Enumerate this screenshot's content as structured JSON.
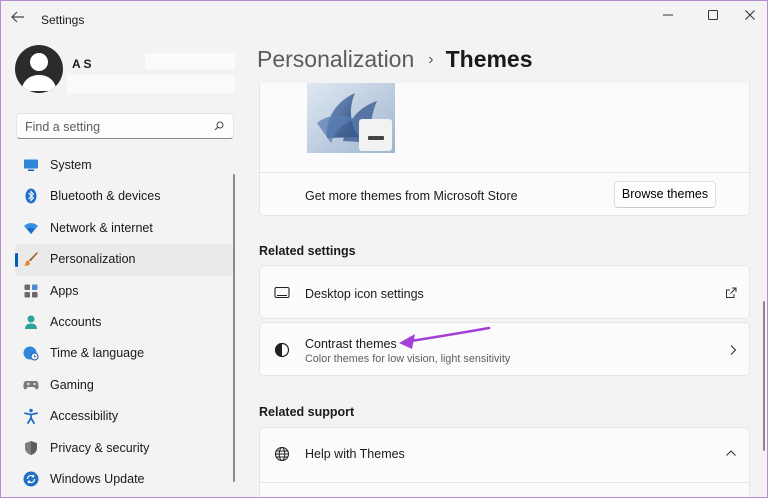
{
  "window": {
    "title": "Settings"
  },
  "profile": {
    "name": "A      S"
  },
  "search": {
    "placeholder": "Find a setting"
  },
  "nav": {
    "items": [
      {
        "label": "System",
        "icon": "monitor-icon"
      },
      {
        "label": "Bluetooth & devices",
        "icon": "bluetooth-icon"
      },
      {
        "label": "Network & internet",
        "icon": "wifi-icon"
      },
      {
        "label": "Personalization",
        "icon": "brush-icon",
        "active": true
      },
      {
        "label": "Apps",
        "icon": "apps-icon"
      },
      {
        "label": "Accounts",
        "icon": "person-icon"
      },
      {
        "label": "Time & language",
        "icon": "globe-clock-icon"
      },
      {
        "label": "Gaming",
        "icon": "gamepad-icon"
      },
      {
        "label": "Accessibility",
        "icon": "accessibility-icon"
      },
      {
        "label": "Privacy & security",
        "icon": "shield-icon"
      },
      {
        "label": "Windows Update",
        "icon": "update-icon"
      }
    ]
  },
  "breadcrumb": {
    "parent": "Personalization",
    "separator": "›",
    "current": "Themes"
  },
  "store": {
    "text": "Get more themes from Microsoft Store",
    "button": "Browse themes"
  },
  "related_settings": {
    "heading": "Related settings",
    "desktop_icons": {
      "title": "Desktop icon settings",
      "icon": "desktop-icon",
      "trail_icon": "external-link-icon"
    },
    "contrast": {
      "title": "Contrast themes",
      "subtitle": "Color themes for low vision, light sensitivity",
      "icon": "contrast-icon",
      "trail_icon": "chevron-right-icon"
    }
  },
  "related_support": {
    "heading": "Related support",
    "help": {
      "title": "Help with Themes",
      "icon": "globe-icon",
      "trail_icon": "chevron-up-icon"
    }
  },
  "colors": {
    "accent": "#005fb8",
    "annotation_arrow": "#a43fd8",
    "window_border": "#b98ad0"
  }
}
